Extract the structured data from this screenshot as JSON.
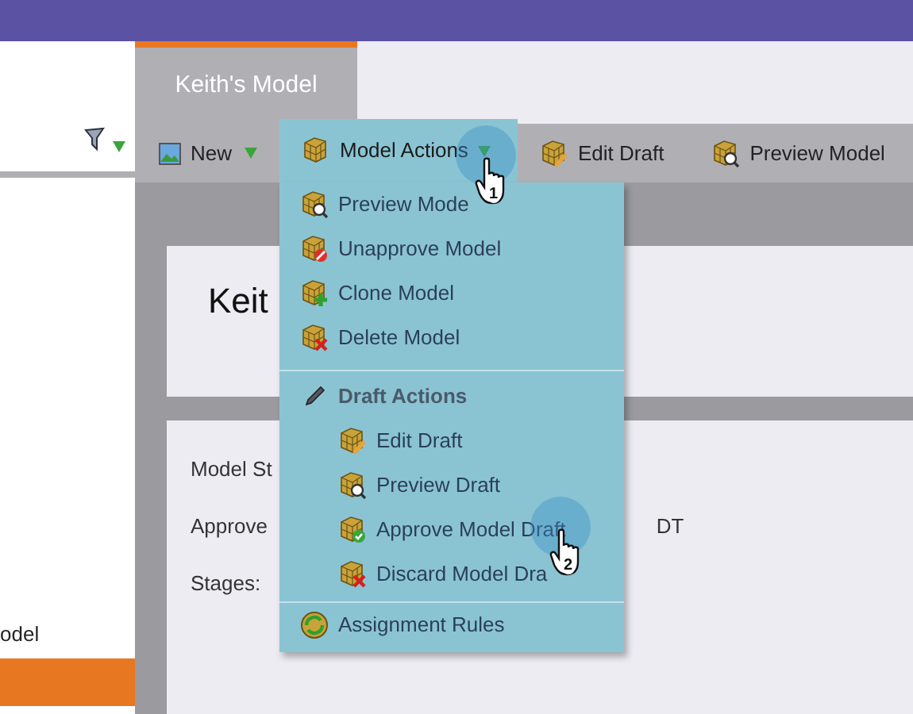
{
  "left_panel": {
    "text": "odel"
  },
  "tab": {
    "label": "Keith's Model",
    "selected": true
  },
  "toolbar": [
    {
      "label": "New",
      "dropdown": true
    },
    {
      "label": "Edit Draft",
      "dropdown": false
    },
    {
      "label": "Preview Model",
      "dropdown": false
    }
  ],
  "menu": {
    "title": "Model Actions",
    "items": [
      {
        "kind": "item",
        "label": "Preview Mode"
      },
      {
        "kind": "item",
        "label": "Unapprove Model"
      },
      {
        "kind": "item",
        "label": "Clone Model"
      },
      {
        "kind": "item",
        "label": "Delete Model"
      },
      {
        "kind": "section",
        "label": "Draft Actions",
        "children": [
          {
            "kind": "item",
            "label": "Edit Draft"
          },
          {
            "kind": "item",
            "label": "Preview Draft"
          },
          {
            "kind": "item",
            "label": "Approve Model Draft"
          },
          {
            "kind": "item",
            "label": "Discard Model Dra"
          }
        ]
      },
      {
        "kind": "item",
        "label": "Assignment Rules"
      }
    ]
  },
  "cards": [
    {
      "title": "Keit"
    },
    {
      "fields": [
        "Model St",
        "Approve",
        "Stages:"
      ],
      "value": "DT"
    }
  ],
  "cursors": [
    {
      "step": "1"
    },
    {
      "step": "2"
    }
  ]
}
